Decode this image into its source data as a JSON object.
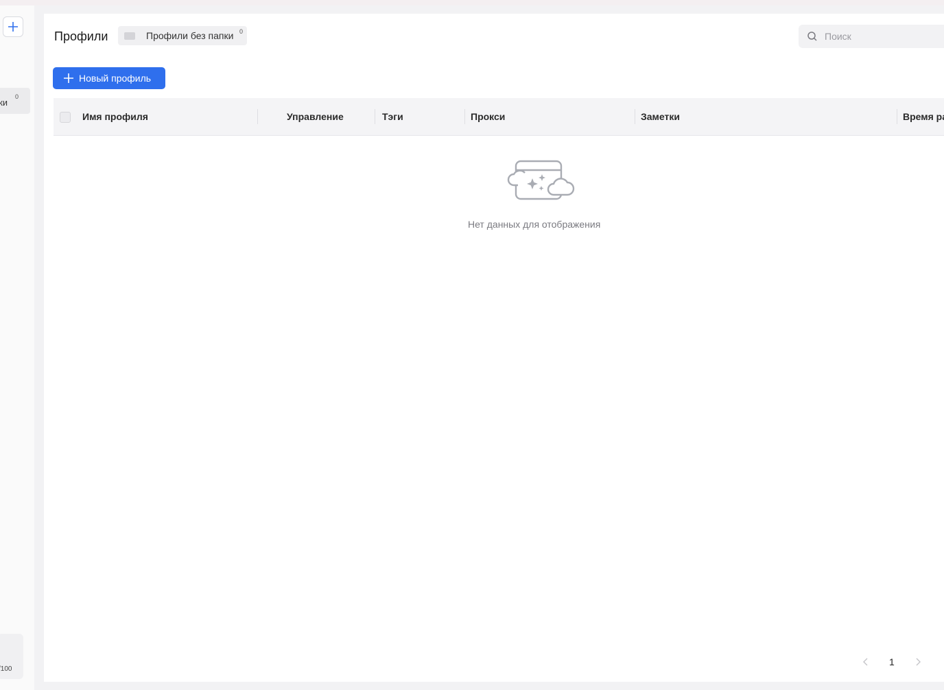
{
  "sidebar": {
    "folder_partial_label": "ки",
    "folder_count": "0",
    "quota_text": "/100"
  },
  "header": {
    "title": "Профили",
    "folder_chip": {
      "label": "Профили без папки",
      "count": "0"
    },
    "search": {
      "placeholder": "Поиск",
      "value": ""
    }
  },
  "toolbar": {
    "new_profile_label": "Новый профиль"
  },
  "table": {
    "columns": [
      "Имя профиля",
      "Управление",
      "Тэги",
      "Прокси",
      "Заметки",
      "Время ра"
    ],
    "rows": [],
    "empty_text": "Нет данных для отображения"
  },
  "pagination": {
    "current_page": "1"
  },
  "colors": {
    "accent": "#2f6fed",
    "header_bg": "#f4f4f6"
  }
}
